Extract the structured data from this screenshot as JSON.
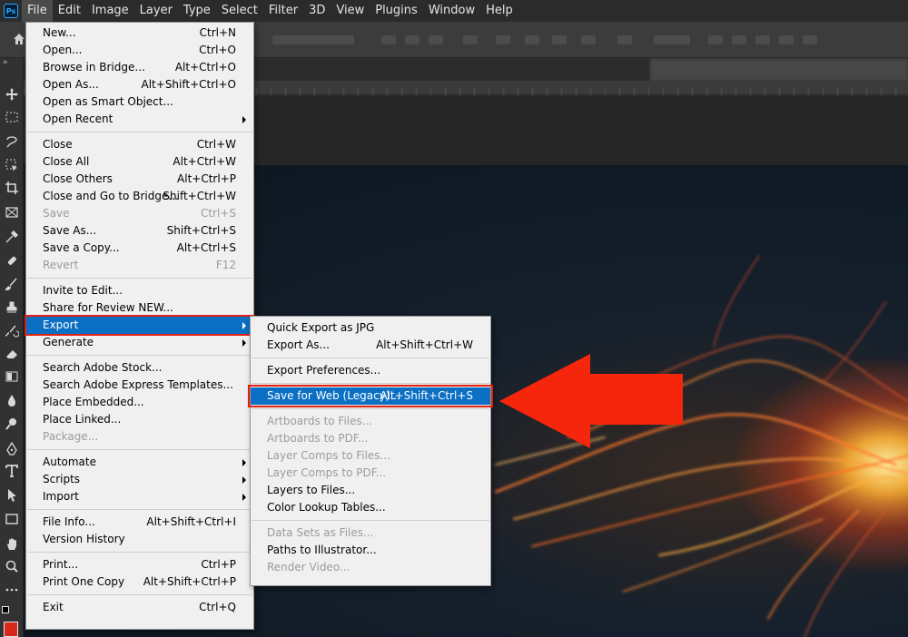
{
  "menubar": {
    "app_icon": "Ps",
    "items": [
      "File",
      "Edit",
      "Image",
      "Layer",
      "Type",
      "Select",
      "Filter",
      "3D",
      "View",
      "Plugins",
      "Window",
      "Help"
    ]
  },
  "file_menu": {
    "groups": [
      [
        {
          "label": "New...",
          "shortcut": "Ctrl+N"
        },
        {
          "label": "Open...",
          "shortcut": "Ctrl+O"
        },
        {
          "label": "Browse in Bridge...",
          "shortcut": "Alt+Ctrl+O"
        },
        {
          "label": "Open As...",
          "shortcut": "Alt+Shift+Ctrl+O"
        },
        {
          "label": "Open as Smart Object...",
          "shortcut": ""
        },
        {
          "label": "Open Recent",
          "shortcut": "",
          "submenu": true
        }
      ],
      [
        {
          "label": "Close",
          "shortcut": "Ctrl+W"
        },
        {
          "label": "Close All",
          "shortcut": "Alt+Ctrl+W"
        },
        {
          "label": "Close Others",
          "shortcut": "Alt+Ctrl+P"
        },
        {
          "label": "Close and Go to Bridge...",
          "shortcut": "Shift+Ctrl+W"
        },
        {
          "label": "Save",
          "shortcut": "Ctrl+S",
          "disabled": true
        },
        {
          "label": "Save As...",
          "shortcut": "Shift+Ctrl+S"
        },
        {
          "label": "Save a Copy...",
          "shortcut": "Alt+Ctrl+S"
        },
        {
          "label": "Revert",
          "shortcut": "F12",
          "disabled": true
        }
      ],
      [
        {
          "label": "Invite to Edit...",
          "shortcut": ""
        },
        {
          "label": "Share for Review NEW...",
          "shortcut": ""
        },
        {
          "label": "Export",
          "shortcut": "",
          "submenu": true,
          "highlighted": true
        },
        {
          "label": "Generate",
          "shortcut": "",
          "submenu": true
        }
      ],
      [
        {
          "label": "Search Adobe Stock...",
          "shortcut": ""
        },
        {
          "label": "Search Adobe Express Templates...",
          "shortcut": ""
        },
        {
          "label": "Place Embedded...",
          "shortcut": ""
        },
        {
          "label": "Place Linked...",
          "shortcut": ""
        },
        {
          "label": "Package...",
          "shortcut": "",
          "disabled": true
        }
      ],
      [
        {
          "label": "Automate",
          "shortcut": "",
          "submenu": true
        },
        {
          "label": "Scripts",
          "shortcut": "",
          "submenu": true
        },
        {
          "label": "Import",
          "shortcut": "",
          "submenu": true
        }
      ],
      [
        {
          "label": "File Info...",
          "shortcut": "Alt+Shift+Ctrl+I"
        },
        {
          "label": "Version History",
          "shortcut": ""
        }
      ],
      [
        {
          "label": "Print...",
          "shortcut": "Ctrl+P"
        },
        {
          "label": "Print One Copy",
          "shortcut": "Alt+Shift+Ctrl+P"
        }
      ],
      [
        {
          "label": "Exit",
          "shortcut": "Ctrl+Q"
        }
      ]
    ]
  },
  "export_menu": {
    "groups": [
      [
        {
          "label": "Quick Export as JPG",
          "shortcut": ""
        },
        {
          "label": "Export As...",
          "shortcut": "Alt+Shift+Ctrl+W"
        }
      ],
      [
        {
          "label": "Export Preferences...",
          "shortcut": ""
        }
      ],
      [
        {
          "label": "Save for Web (Legacy)...",
          "shortcut": "Alt+Shift+Ctrl+S",
          "highlighted": true
        }
      ],
      [
        {
          "label": "Artboards to Files...",
          "shortcut": "",
          "disabled": true
        },
        {
          "label": "Artboards to PDF...",
          "shortcut": "",
          "disabled": true
        },
        {
          "label": "Layer Comps to Files...",
          "shortcut": "",
          "disabled": true
        },
        {
          "label": "Layer Comps to PDF...",
          "shortcut": "",
          "disabled": true
        },
        {
          "label": "Layers to Files...",
          "shortcut": ""
        },
        {
          "label": "Color Lookup Tables...",
          "shortcut": ""
        }
      ],
      [
        {
          "label": "Data Sets as Files...",
          "shortcut": "",
          "disabled": true
        },
        {
          "label": "Paths to Illustrator...",
          "shortcut": ""
        },
        {
          "label": "Render Video...",
          "shortcut": "",
          "disabled": true
        }
      ]
    ]
  },
  "tools": [
    "move-icon",
    "marquee-icon",
    "lasso-icon",
    "object-select-icon",
    "crop-icon",
    "frame-icon",
    "eyedropper-icon",
    "healing-brush-icon",
    "brush-icon",
    "clone-stamp-icon",
    "history-brush-icon",
    "eraser-icon",
    "gradient-icon",
    "blur-icon",
    "dodge-icon",
    "pen-icon",
    "type-icon",
    "path-select-icon",
    "rectangle-icon",
    "hand-icon",
    "zoom-icon",
    "more-tools-icon"
  ],
  "colors": {
    "menu_highlight": "#0b6fc4",
    "annotation_red": "#e02010",
    "foreground_swatch": "#d6291c"
  }
}
